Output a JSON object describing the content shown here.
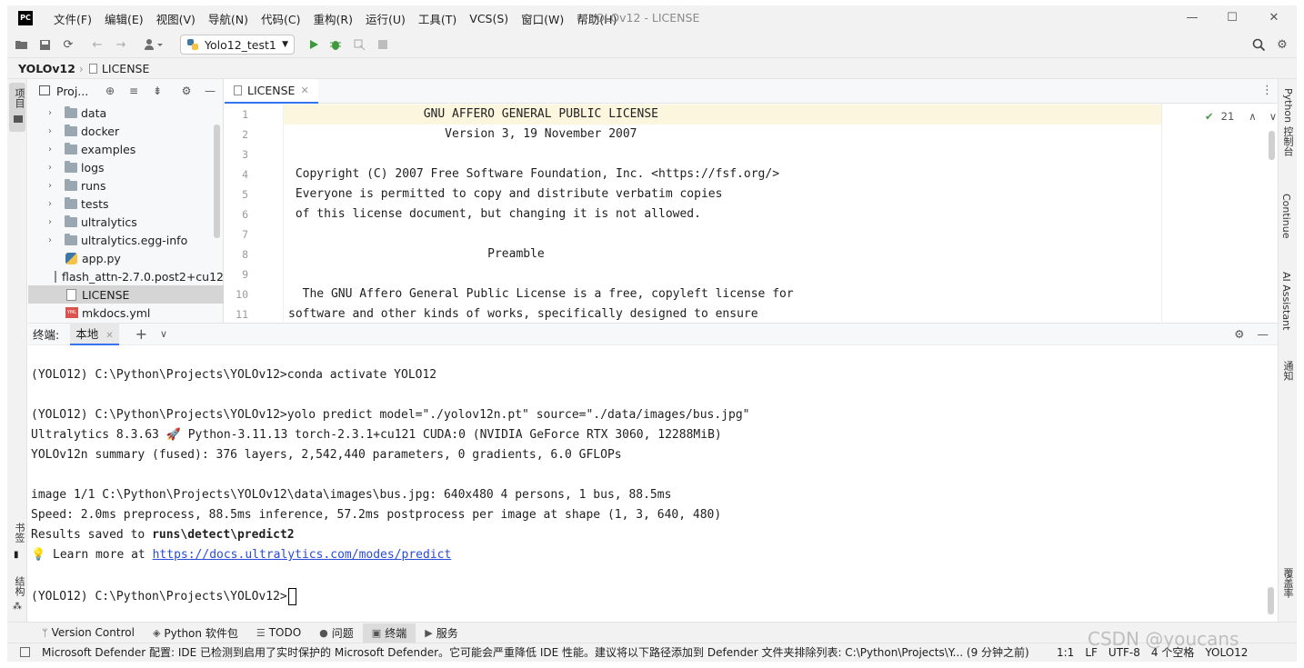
{
  "titlebar": {
    "logo": "PC",
    "menu": [
      "文件(F)",
      "编辑(E)",
      "视图(V)",
      "导航(N)",
      "代码(C)",
      "重构(R)",
      "运行(U)",
      "工具(T)",
      "VCS(S)",
      "窗口(W)",
      "帮助(H)"
    ],
    "window_title": "YOLOv12 - LICENSE"
  },
  "toolbar": {
    "run_config": "Yolo12_test1"
  },
  "breadcrumb": {
    "root": "YOLOv12",
    "file": "LICENSE"
  },
  "project": {
    "header": "Proj...",
    "items": [
      {
        "name": "data",
        "type": "folder"
      },
      {
        "name": "docker",
        "type": "folder"
      },
      {
        "name": "examples",
        "type": "folder"
      },
      {
        "name": "logs",
        "type": "folder"
      },
      {
        "name": "runs",
        "type": "folder"
      },
      {
        "name": "tests",
        "type": "folder"
      },
      {
        "name": "ultralytics",
        "type": "folder"
      },
      {
        "name": "ultralytics.egg-info",
        "type": "folder"
      },
      {
        "name": "app.py",
        "type": "py"
      },
      {
        "name": "flash_attn-2.7.0.post2+cu12",
        "type": "file"
      },
      {
        "name": "LICENSE",
        "type": "file"
      },
      {
        "name": "mkdocs.yml",
        "type": "yml"
      }
    ]
  },
  "editor": {
    "tab": "LICENSE",
    "inspection_count": "21",
    "lines": [
      {
        "n": "1",
        "text": "                   GNU AFFERO GENERAL PUBLIC LICENSE"
      },
      {
        "n": "2",
        "text": "                      Version 3, 19 November 2007"
      },
      {
        "n": "3",
        "text": ""
      },
      {
        "n": "4",
        "text": " Copyright (C) 2007 Free Software Foundation, Inc. <https://fsf.org/>"
      },
      {
        "n": "5",
        "text": " Everyone is permitted to copy and distribute verbatim copies"
      },
      {
        "n": "6",
        "text": " of this license document, but changing it is not allowed."
      },
      {
        "n": "7",
        "text": ""
      },
      {
        "n": "8",
        "text": "                            Preamble"
      },
      {
        "n": "9",
        "text": ""
      },
      {
        "n": "10",
        "text": "  The GNU Affero General Public License is a free, copyleft license for"
      },
      {
        "n": "11",
        "text": "software and other kinds of works, specifically designed to ensure"
      }
    ]
  },
  "terminal": {
    "label": "终端:",
    "tab": "本地",
    "lines": [
      "(YOLO12) C:\\Python\\Projects\\YOLOv12>conda activate YOLO12",
      "",
      "(YOLO12) C:\\Python\\Projects\\YOLOv12>yolo predict model=\"./yolov12n.pt\" source=\"./data/images/bus.jpg\"",
      "Ultralytics 8.3.63 🚀 Python-3.11.13 torch-2.3.1+cu121 CUDA:0 (NVIDIA GeForce RTX 3060, 12288MiB)",
      "YOLOv12n summary (fused): 376 layers, 2,542,440 parameters, 0 gradients, 6.0 GFLOPs",
      "",
      "image 1/1 C:\\Python\\Projects\\YOLOv12\\data\\images\\bus.jpg: 640x480 4 persons, 1 bus, 88.5ms",
      "Speed: 2.0ms preprocess, 88.5ms inference, 57.2ms postprocess per image at shape (1, 3, 640, 480)"
    ],
    "results_prefix": "Results saved to ",
    "results_path": "runs\\detect\\predict2",
    "learn_prefix": "💡 Learn more at ",
    "learn_link": "https://docs.ultralytics.com/modes/predict",
    "prompt": "(YOLO12) C:\\Python\\Projects\\YOLOv12>"
  },
  "left_stripe": {
    "project": "项目",
    "bookmarks": "书签",
    "structure": "结构"
  },
  "right_stripe": {
    "python_console": "Python 控制台",
    "continue": "Continue",
    "ai_assistant": "AI Assistant",
    "notifications": "通知",
    "coverage": "覆盖率"
  },
  "toolwindows": [
    "Version Control",
    "Python 软件包",
    "TODO",
    "问题",
    "终端",
    "服务"
  ],
  "status": {
    "message": "Microsoft Defender 配置: IDE 已检测到启用了实时保护的 Microsoft Defender。它可能会严重降低 IDE 性能。建议将以下路径添加到 Defender 文件夹排除列表: C:\\Python\\Projects\\Y... (9 分钟之前)",
    "position": "1:1",
    "line_sep": "LF",
    "encoding": "UTF-8",
    "indent": "4 个空格",
    "interpreter": "YOLO12",
    "watermark": "CSDN @youcans"
  }
}
